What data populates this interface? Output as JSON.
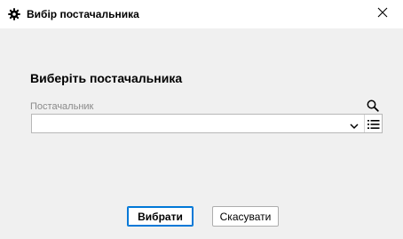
{
  "window": {
    "title": "Вибір постачальника",
    "icon": "gear-icon",
    "close_icon": "close-icon"
  },
  "form": {
    "heading": "Виберіть постачальника",
    "supplier_field": {
      "label": "Постачальник",
      "value": "",
      "search_icon": "search-icon",
      "dropdown_icon": "chevron-down-icon",
      "list_icon": "list-icon"
    }
  },
  "buttons": {
    "select_label": "Вибрати",
    "cancel_label": "Скасувати"
  },
  "colors": {
    "background": "#f0f0f0",
    "titlebar": "#ffffff",
    "accent": "#0078d7",
    "label_gray": "#8a8a8a"
  }
}
